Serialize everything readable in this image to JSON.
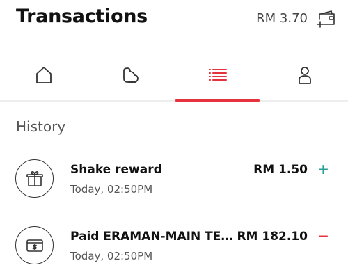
{
  "header": {
    "title": "Transactions",
    "balance": "RM 3.70",
    "wallet_icon": "wallet-add-icon"
  },
  "tabs": [
    {
      "icon": "home-icon",
      "active": false
    },
    {
      "icon": "chat-bubble-icon",
      "active": false
    },
    {
      "icon": "list-icon",
      "active": true
    },
    {
      "icon": "person-icon",
      "active": false
    }
  ],
  "colors": {
    "accent": "#e5333d",
    "credit": "#2a9d9a",
    "debit": "#e5333d"
  },
  "history": {
    "title": "History",
    "transactions": [
      {
        "icon": "gift-icon",
        "title": "Shake reward",
        "time": "Today, 02:50PM",
        "amount": "RM 1.50",
        "sign": "+"
      },
      {
        "icon": "payment-card-icon",
        "title": "Paid ERAMAN-MAIN TE...",
        "time": "Today, 02:50PM",
        "amount": "RM 182.10",
        "sign": "−"
      }
    ]
  }
}
